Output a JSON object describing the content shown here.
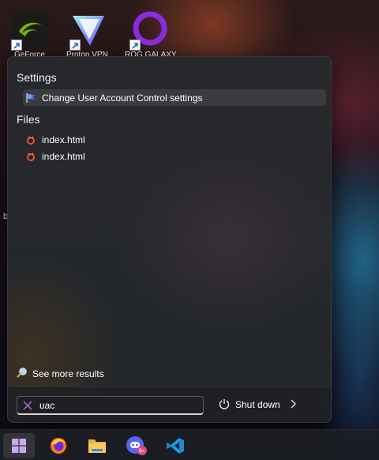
{
  "desktop": {
    "icons": [
      {
        "name": "nvidia-icon",
        "label": "GeForce"
      },
      {
        "name": "proton-vpn-icon",
        "label": "Proton VPN"
      },
      {
        "name": "rog-galaxy-icon",
        "label": "ROG GALAXY"
      }
    ],
    "side_char": "b"
  },
  "search": {
    "sections": [
      {
        "header": "Settings",
        "items": [
          {
            "label": "Change User Account Control settings",
            "icon": "uac-flag-icon"
          }
        ]
      },
      {
        "header": "Files",
        "items": [
          {
            "label": "index.html",
            "icon": "html-file-icon"
          },
          {
            "label": "index.html",
            "icon": "html-file-icon"
          }
        ]
      }
    ],
    "see_more": "See more results",
    "query": "uac"
  },
  "power": {
    "label": "Shut down"
  },
  "taskbar": {
    "items": [
      "start-icon",
      "firefox-icon",
      "file-explorer-icon",
      "discord-icon",
      "vscode-icon"
    ],
    "discord_badge": "9+"
  }
}
